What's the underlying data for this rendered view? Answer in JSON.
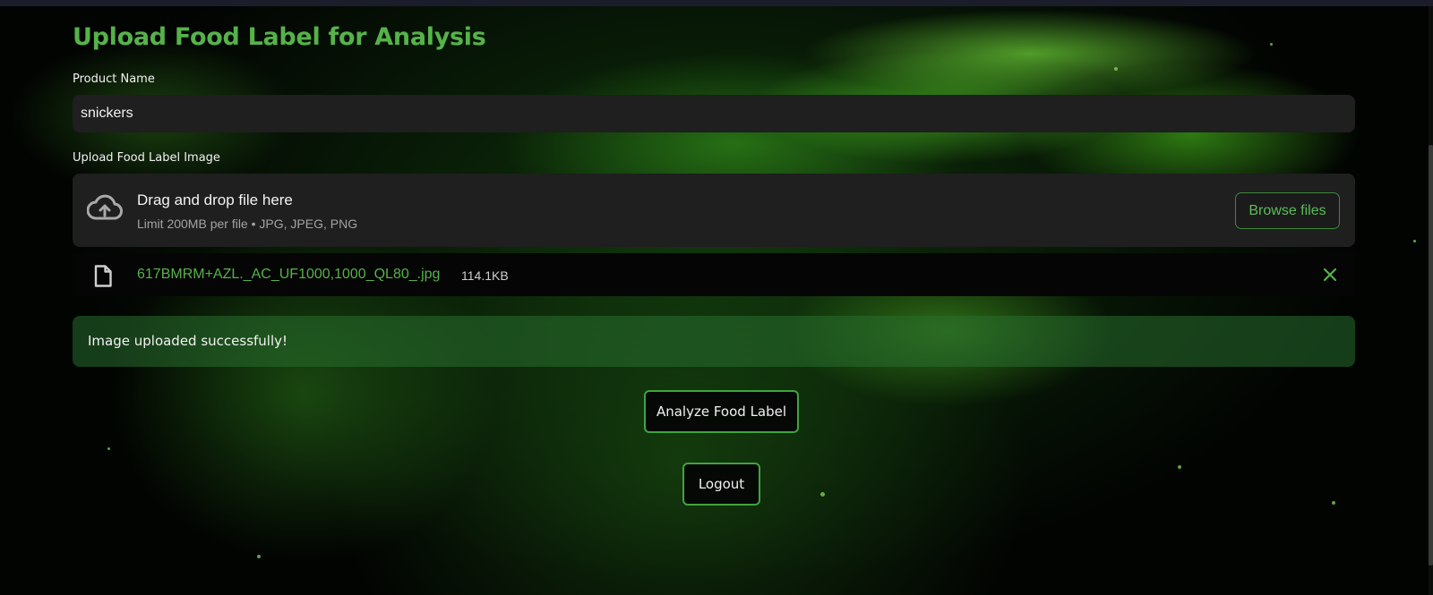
{
  "page": {
    "title": "Upload Food Label for Analysis",
    "accent_color": "#56b24a"
  },
  "product_name": {
    "label": "Product Name",
    "value": "snickers"
  },
  "upload": {
    "label": "Upload Food Label Image",
    "dropzone_title": "Drag and drop file here",
    "dropzone_subtitle": "Limit 200MB per file • JPG, JPEG, PNG",
    "browse_label": "Browse files",
    "icon": "cloud-upload-icon"
  },
  "uploaded_file": {
    "name": "617BMRM+AZL._AC_UF1000,1000_QL80_.jpg",
    "size": "114.1KB",
    "icon": "file-icon",
    "remove_icon": "close-icon"
  },
  "alert": {
    "message": "Image uploaded successfully!",
    "color": "#2a6e2d"
  },
  "actions": {
    "analyze_label": "Analyze Food Label",
    "logout_label": "Logout"
  }
}
